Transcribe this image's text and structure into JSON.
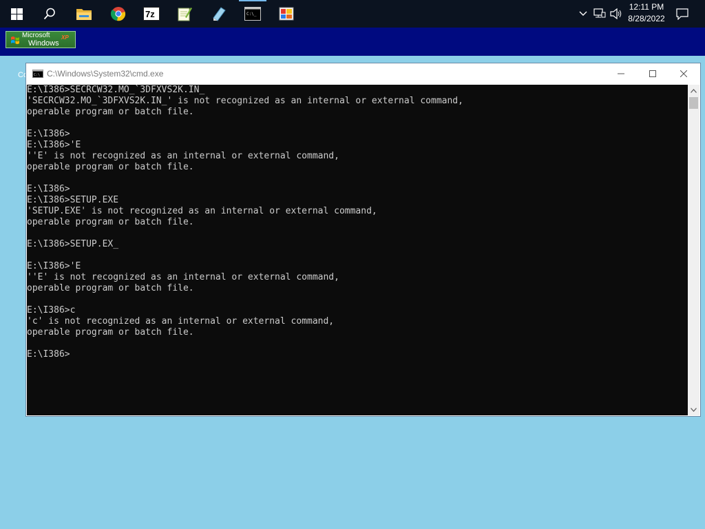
{
  "taskbar": {
    "pinned": [
      {
        "name": "start-button",
        "icon": "windows-logo-icon"
      },
      {
        "name": "search-button",
        "icon": "search-icon"
      },
      {
        "name": "file-explorer-button",
        "icon": "folder-icon"
      },
      {
        "name": "chrome-button",
        "icon": "chrome-icon"
      },
      {
        "name": "7zip-button",
        "icon": "7zip-icon",
        "label": "7z"
      },
      {
        "name": "notepadpp-button",
        "icon": "notepad-icon"
      },
      {
        "name": "notepad-button",
        "icon": "pencil-icon"
      },
      {
        "name": "cmd-button",
        "icon": "terminal-icon",
        "running": true
      },
      {
        "name": "paint-button",
        "icon": "paint-icon"
      }
    ],
    "clock": {
      "time": "12:11 PM",
      "date": "8/28/2022"
    },
    "tray_icons": [
      "chevron-up-icon",
      "network-icon",
      "volume-icon",
      "notification-icon"
    ]
  },
  "banner": {
    "microsoft": "Microsoft",
    "windows": "Windows",
    "xp": "XP"
  },
  "desktop": {
    "partial_label": "Co"
  },
  "window": {
    "title": "C:\\Windows\\System32\\cmd.exe",
    "lines": [
      "E:\\I386>SECRCW32.MO_`3DFXVS2K.IN_",
      "'SECRCW32.MO_`3DFXVS2K.IN_' is not recognized as an internal or external command,",
      "operable program or batch file.",
      "",
      "E:\\I386>",
      "E:\\I386>'E",
      "''E' is not recognized as an internal or external command,",
      "operable program or batch file.",
      "",
      "E:\\I386>",
      "E:\\I386>SETUP.EXE",
      "'SETUP.EXE' is not recognized as an internal or external command,",
      "operable program or batch file.",
      "",
      "E:\\I386>SETUP.EX_",
      "",
      "E:\\I386>'E",
      "''E' is not recognized as an internal or external command,",
      "operable program or batch file.",
      "",
      "E:\\I386>c",
      "'c' is not recognized as an internal or external command,",
      "operable program or batch file.",
      "",
      "E:\\I386>"
    ]
  },
  "colors": {
    "desktop": "#8ccfe8",
    "taskbar": "#0b1320",
    "banner": "#000a80",
    "console_bg": "#0c0c0c",
    "console_fg": "#cccccc"
  }
}
